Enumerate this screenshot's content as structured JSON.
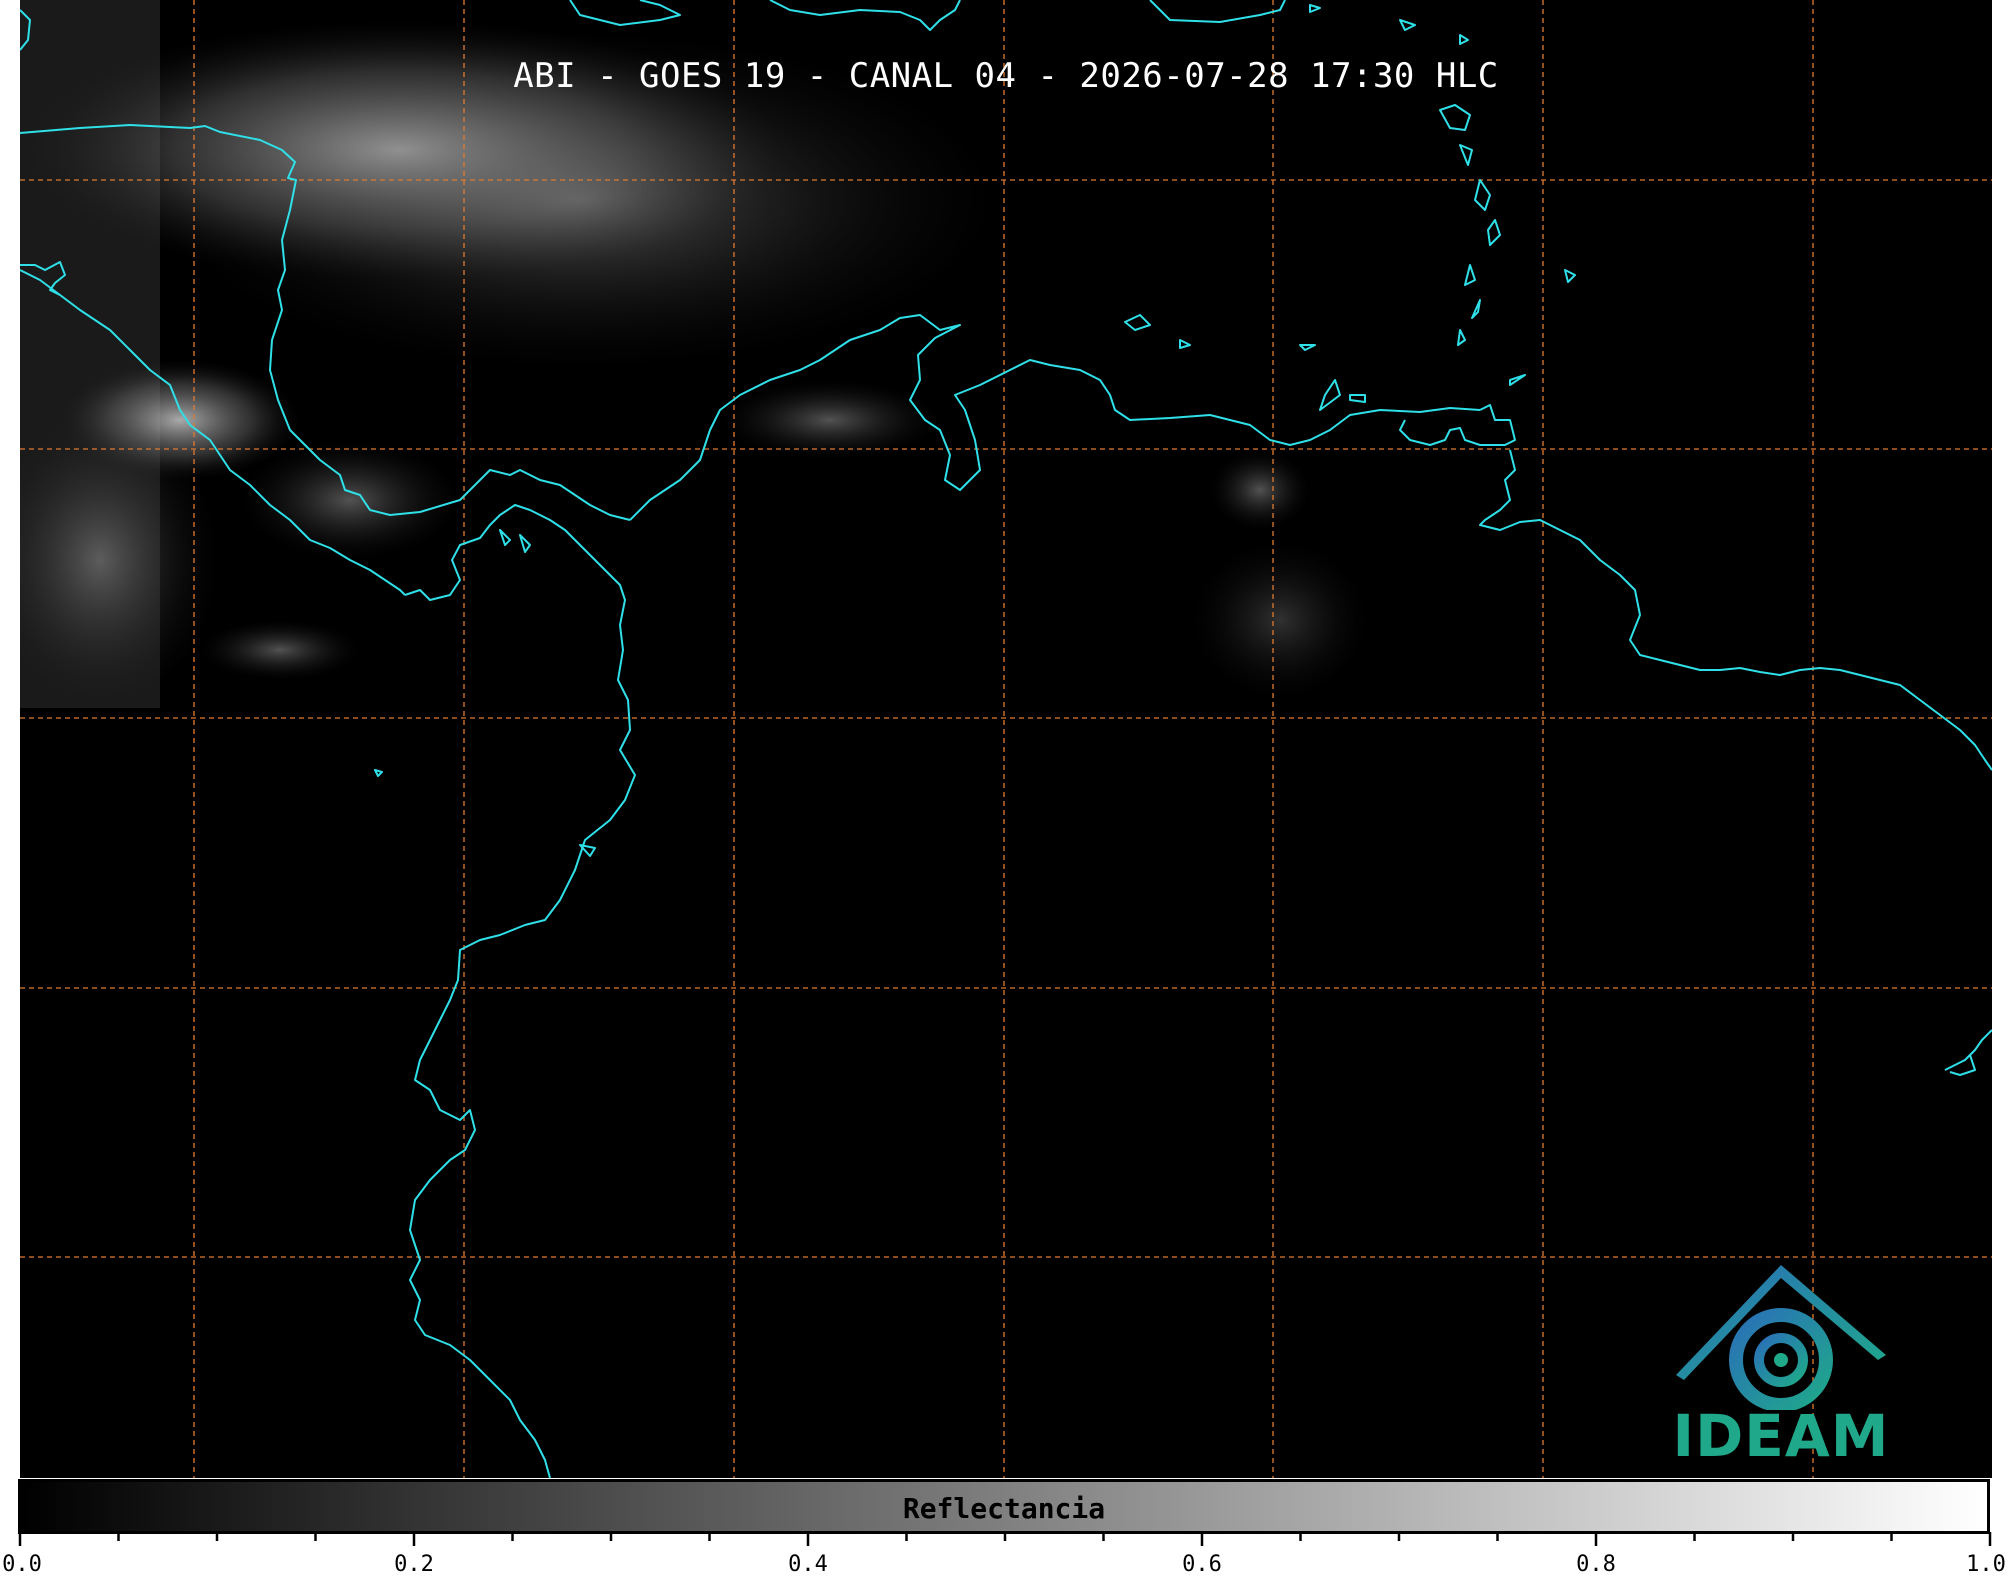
{
  "title": "ABI - GOES 19 - CANAL 04 - 2026-07-28 17:30 HLC",
  "map": {
    "coastline_color": "#2fe0e8",
    "grid_color": "#e07a30",
    "background": "#000000"
  },
  "logo": {
    "text": "IDEAM",
    "icon": "ideam-swirl-logo-icon",
    "colors": [
      "#2a7fb8",
      "#1fa98a"
    ]
  },
  "colorbar": {
    "label": "Reflectancia",
    "min": 0.0,
    "max": 1.0,
    "gradient": [
      "#000000",
      "#ffffff"
    ],
    "tick_labels": [
      "0.0",
      "0.2",
      "0.4",
      "0.6",
      "0.8",
      "1.0"
    ],
    "tick_values": [
      0.0,
      0.2,
      0.4,
      0.6,
      0.8,
      1.0
    ],
    "minor_step": 0.05
  }
}
